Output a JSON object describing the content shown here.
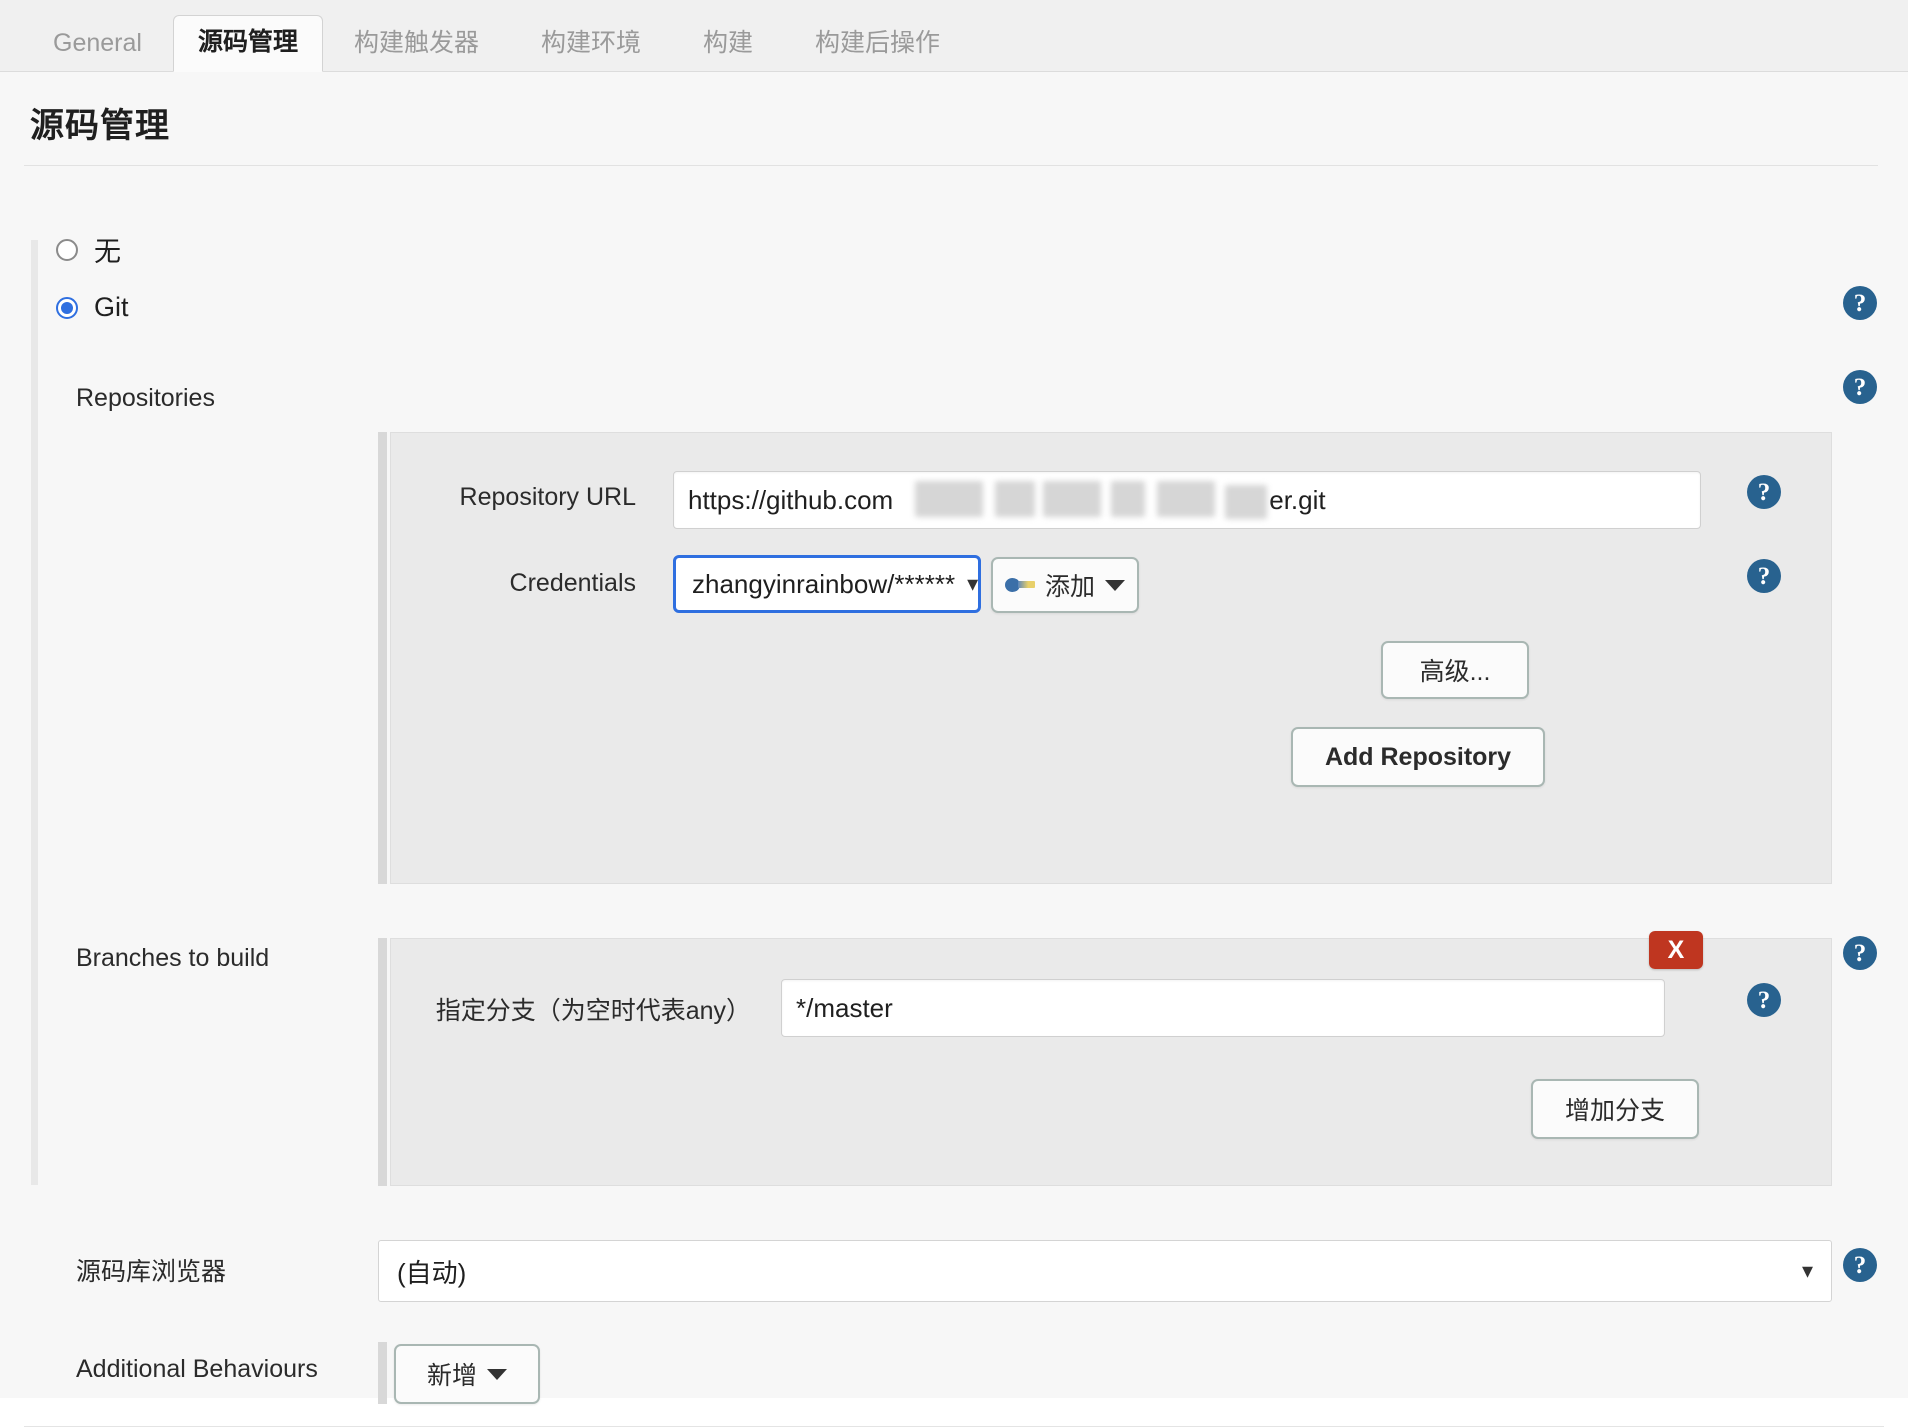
{
  "tabs": [
    {
      "label": "General",
      "active": false
    },
    {
      "label": "源码管理",
      "active": true
    },
    {
      "label": "构建触发器",
      "active": false
    },
    {
      "label": "构建环境",
      "active": false
    },
    {
      "label": "构建",
      "active": false
    },
    {
      "label": "构建后操作",
      "active": false
    }
  ],
  "page": {
    "title": "源码管理"
  },
  "scm_choice": {
    "none_label": "无",
    "none_selected": false,
    "git_label": "Git",
    "git_selected": true
  },
  "repositories": {
    "section_label": "Repositories",
    "url_label": "Repository URL",
    "url_value": "https://github.com",
    "url_value_tail": "er.git",
    "credentials_label": "Credentials",
    "credentials_value": "zhangyinrainbow/******",
    "add_credentials_label": "添加",
    "add_credentials_icon": "key-icon",
    "advanced_label": "高级...",
    "add_repository_label": "Add Repository"
  },
  "branches": {
    "section_label": "Branches to build",
    "branch_spec_label": "指定分支（为空时代表any）",
    "branch_spec_value": "*/master",
    "delete_label": "X",
    "add_branch_label": "增加分支"
  },
  "repo_browser": {
    "section_label": "源码库浏览器",
    "value": "(自动)"
  },
  "additional_behaviours": {
    "section_label": "Additional Behaviours",
    "add_label": "新增"
  },
  "help": {
    "glyph": "?",
    "color": "#28628f"
  },
  "colors": {
    "accent_blue": "#2f6fe0",
    "help_blue": "#28628f",
    "danger_red": "#bf3620",
    "panel_gray": "#eaeaea",
    "page_bg": "#f7f7f7"
  }
}
